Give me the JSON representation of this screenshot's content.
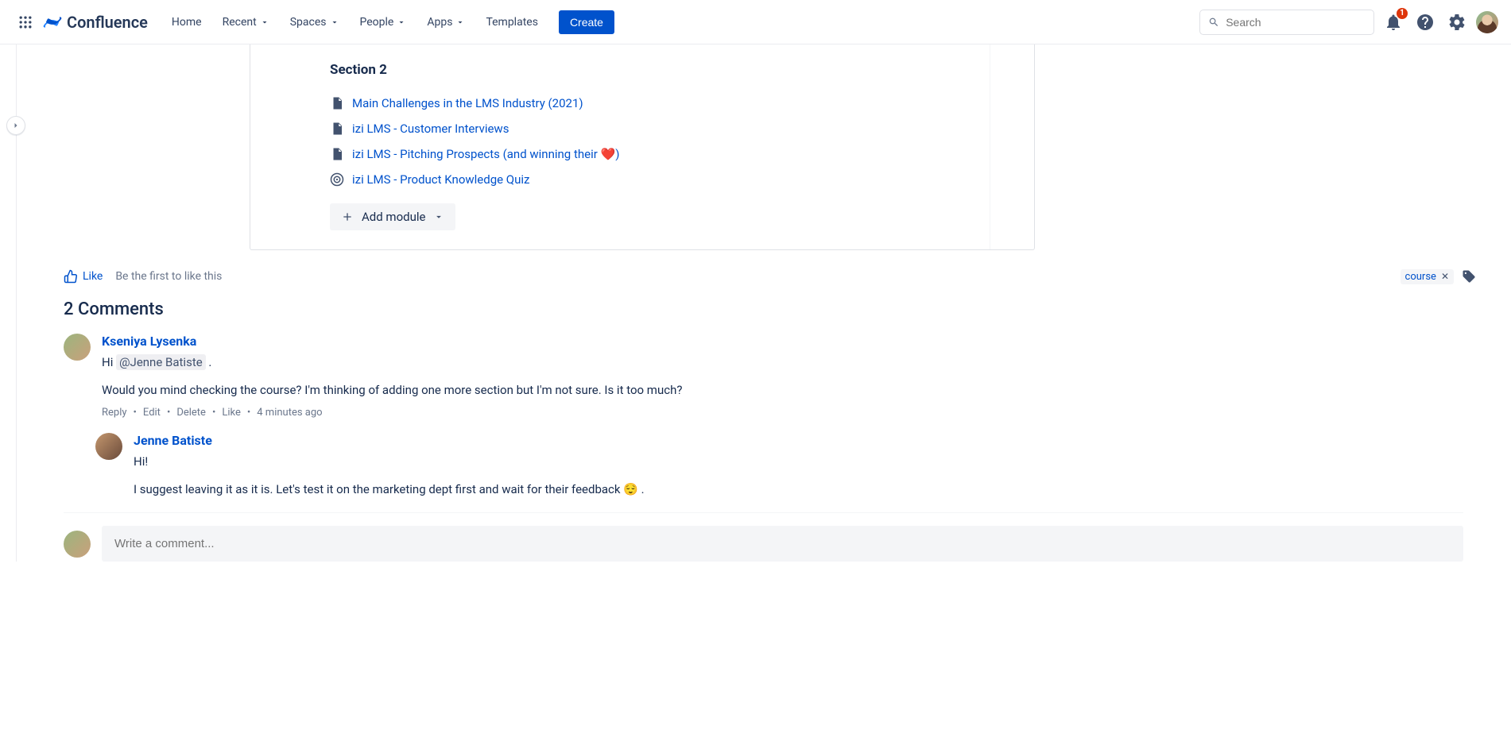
{
  "nav": {
    "brand": "Confluence",
    "home": "Home",
    "recent": "Recent",
    "spaces": "Spaces",
    "people": "People",
    "apps": "Apps",
    "templates": "Templates",
    "create": "Create",
    "search_placeholder": "Search",
    "notif_count": "1"
  },
  "section": {
    "title": "Section 2",
    "items": [
      {
        "label": "Main Challenges in the LMS Industry (2021)",
        "icon": "page"
      },
      {
        "label": "izi LMS - Customer Interviews",
        "icon": "page"
      },
      {
        "label_prefix": "izi LMS - Pitching Prospects (and winning their ",
        "label_suffix": ")",
        "icon": "page",
        "heart": true
      },
      {
        "label": "izi LMS - Product Knowledge Quiz",
        "icon": "quiz"
      }
    ],
    "add_module": "Add module"
  },
  "like": {
    "label": "Like",
    "info": "Be the first to like this",
    "tag": "course"
  },
  "comments": {
    "title": "2 Comments",
    "items": [
      {
        "author": "Kseniya Lysenka",
        "hi": "Hi ",
        "mention": "@Jenne Batiste",
        "period": " .",
        "body2": "Would you mind checking the course? I'm thinking of adding one more section but I'm not sure. Is it too much?",
        "actions": {
          "reply": "Reply",
          "edit": "Edit",
          "delete": "Delete",
          "like": "Like",
          "time": "4 minutes ago"
        }
      },
      {
        "author": "Jenne Batiste",
        "body1": "Hi!",
        "body2_pre": "I suggest leaving it as it is. Let's test it on the marketing dept first and wait for their feedback ",
        "body2_post": " ."
      }
    ],
    "input_placeholder": "Write a comment..."
  }
}
